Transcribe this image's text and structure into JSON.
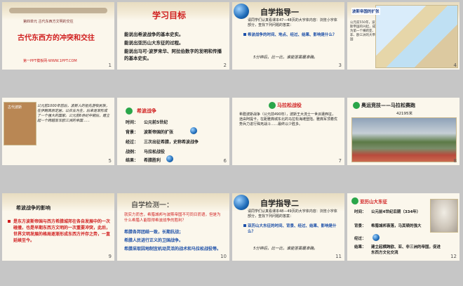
{
  "slides": [
    {
      "number": "1",
      "unit": "第四单元 古代东西方文明的交往",
      "title": "古代东西方的冲突和交往",
      "footer": "第一PPT模板网-WWW.1PPT.COM"
    },
    {
      "number": "2",
      "title": "学习目标",
      "items": [
        "能说出希波战争的基本史实。",
        "能说出亚历山大东征的过程。",
        "能说出马可·波罗来华、阿拉伯数字的发明和传播的基本史实。"
      ]
    },
    {
      "number": "3",
      "title": "自学指导一",
      "intro": "请同学们认真看课本47—48页的大字体内容：浏览小字体部分，查找下列问题的答案：",
      "question": "希波战争的时间、地点、经过、结果、影响是什么？",
      "note": "5分钟后，比一比，谁能答案最准确。"
    },
    {
      "number": "4",
      "map_title": "波斯帝国的扩张",
      "map_text": "公元前550年，波斯帝国的兴起，成为第一个横跨亚、非、欧三洲的大帝国"
    },
    {
      "number": "5",
      "label": "古代波斯",
      "text": "公元前1000年前后，波斯人的祖先游牧民族，在伊朗高原定居，以农业为生，后来逐渐形成了一个强大的国家。公元前6世纪中期后，建立起一个跨越亚非欧三洲的帝国……"
    },
    {
      "number": "6",
      "heading": "希波战争",
      "rows": [
        {
          "k": "时间：",
          "v": "公元前5世纪"
        },
        {
          "k": "背景：",
          "v": "波斯帝国的扩张"
        },
        {
          "k": "经过：",
          "v": "三次出征希腊，史称希波战争"
        },
        {
          "k": "战例：",
          "v": "马拉松战役"
        },
        {
          "k": "结果：",
          "v": "希腊胜利"
        }
      ]
    },
    {
      "number": "7",
      "heading": "马拉松战役",
      "text": "希腊波斯战争（公元前490年），波斯王大流士一世派遣西征，途由阿提卡，在距雅典城东北的马拉松海滩登陆。雅典军顶着优势兵力进行殊死战斗……最终以少胜多。"
    },
    {
      "number": "8",
      "heading": "奥运竞技——马拉松赛跑",
      "distance": "42195米"
    },
    {
      "number": "9",
      "heading": "希波战争的影响",
      "text": "是东方波斯帝国与西方希腊城邦在各自发展中的一次碰撞，也是早期东西方文明的一次重要冲突，此后，世界文明发展的格局逐渐形成东西方并存之势，一直延续至今。"
    },
    {
      "number": "10",
      "heading": "自学检测一：",
      "q": "就实力而言，希腊城邦与波斯帝国不可同日而语，但是为什么希腊人能取得希波战争的胜利？",
      "a1": "希腊各邦团结一致，长期抗战；",
      "a2": "希腊人民进行正义的卫国战争。",
      "a3": "希腊采取因地制宜机动灵活的战术和马拉松战役等。"
    },
    {
      "number": "11",
      "title": "自学指导二",
      "intro": "请同学们认真看课本48—49页的大字体内容：浏览小字体部分，查找下列问题的答案：",
      "question": "亚历山大东征的时间、背景、经过、结果、影响是什么？",
      "note": "5分钟后，比一比，谁能答案最准确。"
    },
    {
      "number": "12",
      "heading": "亚历山大东征",
      "rows": [
        {
          "k": "时间：",
          "v": "公元前4世纪后期（334年）"
        },
        {
          "k": "背景：",
          "v": "希腊城邦衰落，马其顿的强大"
        },
        {
          "k": "经过：",
          "v": ""
        },
        {
          "k": "结果：",
          "v": "建立起横跨欧、亚、非三洲的帝国，促进东西方文化交流"
        }
      ]
    }
  ]
}
